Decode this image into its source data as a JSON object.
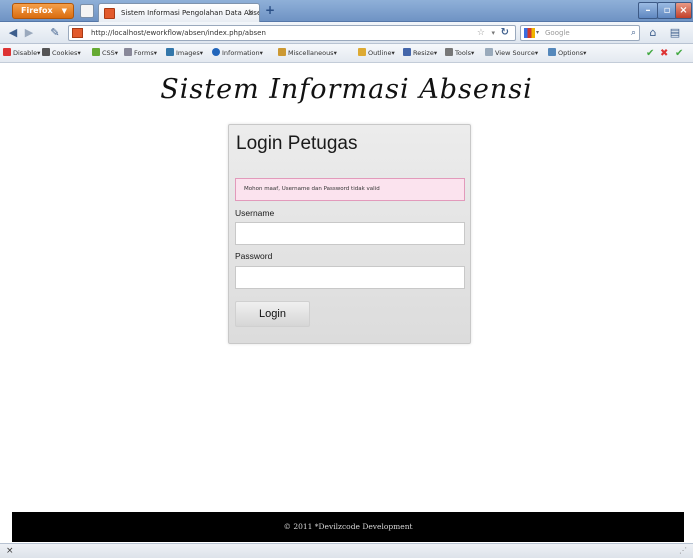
{
  "browser": {
    "firefox_button": "Firefox",
    "tab_title": "Sistem Informasi Pengolahan Data Absen...",
    "url": "http://localhost/eworkflow/absen/index.php/absen",
    "search_placeholder": "Google"
  },
  "toolbar": {
    "items": [
      "Disable",
      "Cookies",
      "CSS",
      "Forms",
      "Images",
      "Information",
      "Miscellaneous",
      "Outline",
      "Resize",
      "Tools",
      "View Source",
      "Options"
    ]
  },
  "page": {
    "site_title": "Sistem Informasi Absensi",
    "login": {
      "heading": "Login Petugas",
      "error_message": "Mohon maaf, Username dan Password tidak valid",
      "username_label": "Username",
      "username_value": "",
      "password_label": "Password",
      "password_value": "",
      "button_label": "Login"
    },
    "footer_text": "© 2011 *Devilzcode Development"
  },
  "statusbar": {
    "close_glyph": "×"
  },
  "colors": {
    "error_bg": "#fbe3ee",
    "error_border": "#e29abb",
    "footer_bg": "#000000",
    "firefox_orange": "#e47a1d"
  }
}
